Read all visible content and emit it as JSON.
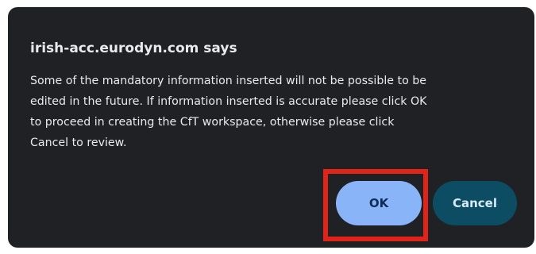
{
  "dialog": {
    "title": "irish-acc.eurodyn.com says",
    "message_lines": [
      "Some of the mandatory information inserted will not be possible to be",
      "edited in the future. If information inserted is accurate please click OK",
      "to proceed in creating the CfT workspace, otherwise please click",
      "Cancel to review."
    ],
    "ok_label": "OK",
    "cancel_label": "Cancel"
  },
  "colors": {
    "dialog_background": "#202124",
    "text": "#e8eaed",
    "ok_button": "#8ab4f8",
    "cancel_button": "#0d4d63",
    "highlight": "#e2231a"
  }
}
